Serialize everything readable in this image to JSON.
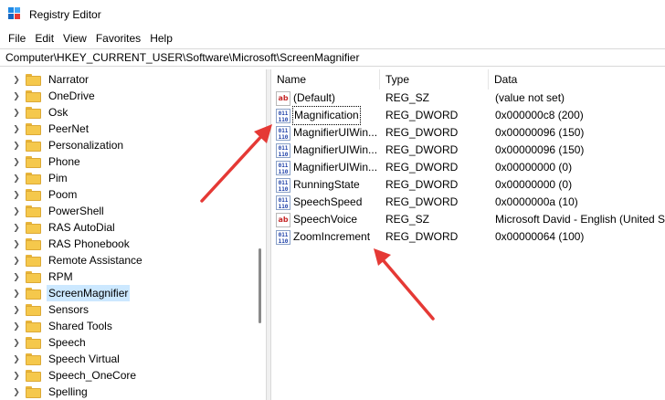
{
  "window": {
    "title": "Registry Editor"
  },
  "menu": [
    "File",
    "Edit",
    "View",
    "Favorites",
    "Help"
  ],
  "address": "Computer\\HKEY_CURRENT_USER\\Software\\Microsoft\\ScreenMagnifier",
  "tree": {
    "items": [
      {
        "label": "Narrator",
        "selected": false
      },
      {
        "label": "OneDrive",
        "selected": false
      },
      {
        "label": "Osk",
        "selected": false
      },
      {
        "label": "PeerNet",
        "selected": false
      },
      {
        "label": "Personalization",
        "selected": false
      },
      {
        "label": "Phone",
        "selected": false
      },
      {
        "label": "Pim",
        "selected": false
      },
      {
        "label": "Poom",
        "selected": false
      },
      {
        "label": "PowerShell",
        "selected": false
      },
      {
        "label": "RAS AutoDial",
        "selected": false
      },
      {
        "label": "RAS Phonebook",
        "selected": false
      },
      {
        "label": "Remote Assistance",
        "selected": false
      },
      {
        "label": "RPM",
        "selected": false
      },
      {
        "label": "ScreenMagnifier",
        "selected": true
      },
      {
        "label": "Sensors",
        "selected": false
      },
      {
        "label": "Shared Tools",
        "selected": false
      },
      {
        "label": "Speech",
        "selected": false
      },
      {
        "label": "Speech Virtual",
        "selected": false
      },
      {
        "label": "Speech_OneCore",
        "selected": false
      },
      {
        "label": "Spelling",
        "selected": false
      }
    ]
  },
  "list": {
    "headers": {
      "name": "Name",
      "type": "Type",
      "data": "Data"
    },
    "rows": [
      {
        "icon": "string-value-icon",
        "name": "(Default)",
        "type": "REG_SZ",
        "data": "(value not set)"
      },
      {
        "icon": "binary-value-icon",
        "name": "Magnification",
        "type": "REG_DWORD",
        "data": "0x000000c8 (200)"
      },
      {
        "icon": "binary-value-icon",
        "name": "MagnifierUIWin...",
        "type": "REG_DWORD",
        "data": "0x00000096 (150)"
      },
      {
        "icon": "binary-value-icon",
        "name": "MagnifierUIWin...",
        "type": "REG_DWORD",
        "data": "0x00000096 (150)"
      },
      {
        "icon": "binary-value-icon",
        "name": "MagnifierUIWin...",
        "type": "REG_DWORD",
        "data": "0x00000000 (0)"
      },
      {
        "icon": "binary-value-icon",
        "name": "RunningState",
        "type": "REG_DWORD",
        "data": "0x00000000 (0)"
      },
      {
        "icon": "binary-value-icon",
        "name": "SpeechSpeed",
        "type": "REG_DWORD",
        "data": "0x0000000a (10)"
      },
      {
        "icon": "string-value-icon",
        "name": "SpeechVoice",
        "type": "REG_SZ",
        "data": "Microsoft David - English (United S"
      },
      {
        "icon": "binary-value-icon",
        "name": "ZoomIncrement",
        "type": "REG_DWORD",
        "data": "0x00000064 (100)"
      }
    ]
  },
  "colors": {
    "annotation_arrow": "#e53935",
    "selection": "#cce8ff",
    "folder": "#f5c84c"
  }
}
